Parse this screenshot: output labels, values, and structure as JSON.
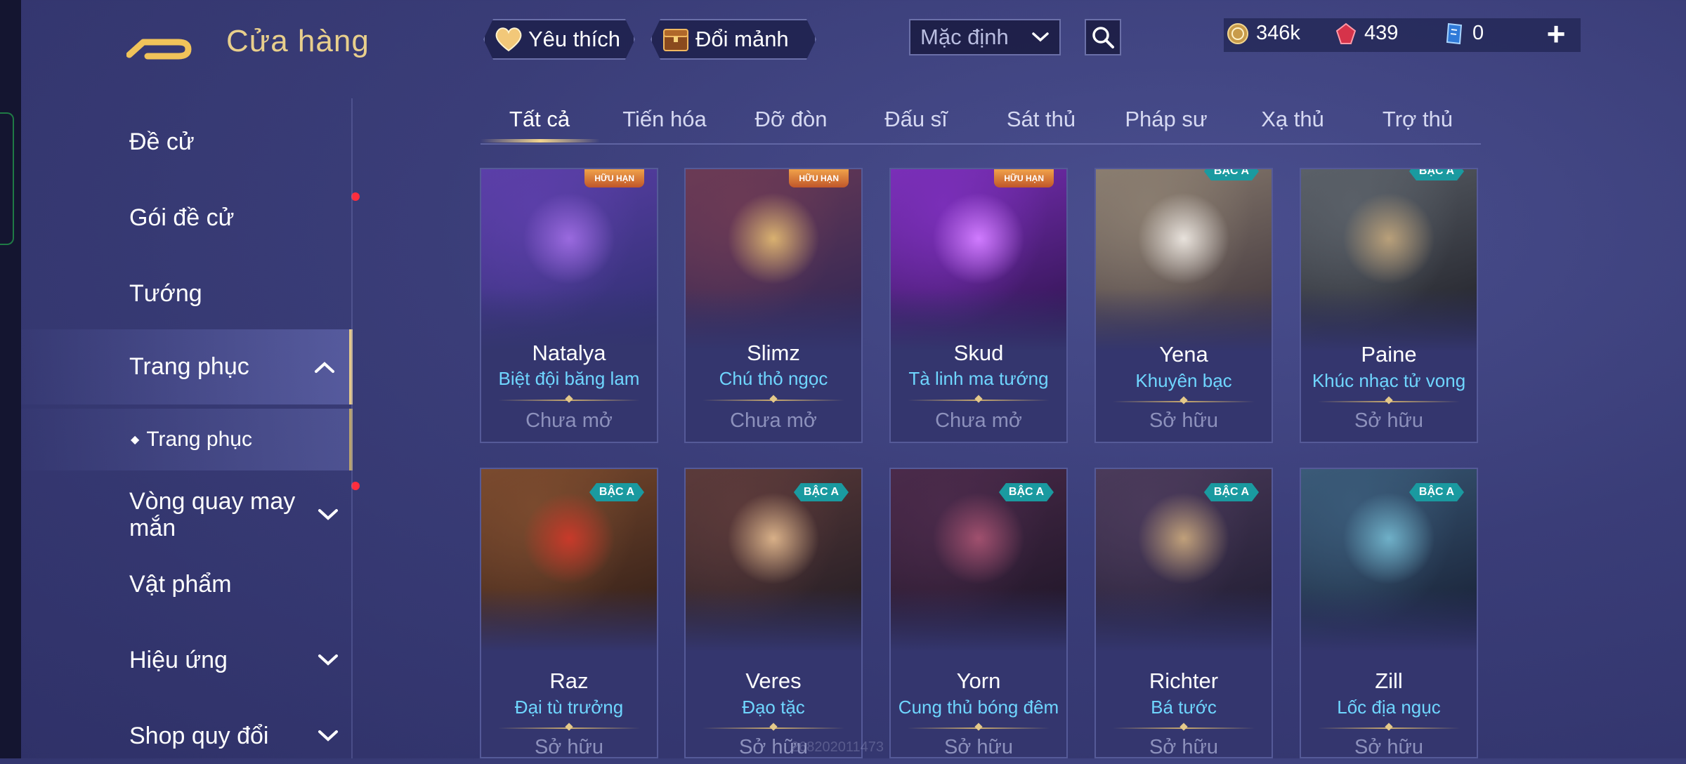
{
  "header": {
    "title": "Cửa hàng",
    "favorites_label": "Yêu thích",
    "fragments_label": "Đổi mảnh",
    "sort_value": "Mặc định",
    "currencies": {
      "gold": "346k",
      "ruby": "439",
      "voucher": "0"
    },
    "add_label": "+"
  },
  "sidebar": {
    "items": [
      {
        "label": "Đề cử"
      },
      {
        "label": "Gói đề cử"
      },
      {
        "label": "Tướng"
      },
      {
        "label": "Trang phục"
      },
      {
        "label": "Trang phục"
      },
      {
        "label": "Vòng quay may mắn"
      },
      {
        "label": "Vật phẩm"
      },
      {
        "label": "Hiệu ứng"
      },
      {
        "label": "Shop quy đổi"
      }
    ]
  },
  "tabs": [
    {
      "label": "Tất cả"
    },
    {
      "label": "Tiến hóa"
    },
    {
      "label": "Đỡ đòn"
    },
    {
      "label": "Đấu sĩ"
    },
    {
      "label": "Sát thủ"
    },
    {
      "label": "Pháp sư"
    },
    {
      "label": "Xạ thủ"
    },
    {
      "label": "Trợ thủ"
    }
  ],
  "skins": [
    {
      "hero": "Natalya",
      "skin": "Biệt đội băng lam",
      "status": "Chưa mở",
      "badge": "HỮU HẠN",
      "art": [
        "#5b3fa8",
        "#2d2f6e",
        "#9a6adf"
      ]
    },
    {
      "hero": "Slimz",
      "skin": "Chú thỏ ngọc",
      "status": "Chưa mở",
      "badge": "HỮU HẠN",
      "art": [
        "#6b3a55",
        "#2c2555",
        "#d9b170"
      ]
    },
    {
      "hero": "Skud",
      "skin": "Tà linh ma tướng",
      "status": "Chưa mở",
      "badge": "HỮU HẠN",
      "art": [
        "#7a2fb8",
        "#2a1248",
        "#d07bff"
      ]
    },
    {
      "hero": "Yena",
      "skin": "Khuyên bạc",
      "status": "Sở hữu",
      "badge": "BẬC A",
      "art": [
        "#8a7d70",
        "#3b3038",
        "#e8e2dc"
      ]
    },
    {
      "hero": "Paine",
      "skin": "Khúc nhạc tử vong",
      "status": "Sở hữu",
      "badge": "BẬC A",
      "art": [
        "#5a6068",
        "#1c1c24",
        "#b9a07a"
      ]
    },
    {
      "hero": "Raz",
      "skin": "Đại tù trưởng",
      "status": "Sở hữu",
      "badge": "BẬC A",
      "art": [
        "#7a4a2e",
        "#2a1a16",
        "#c83a2a"
      ]
    },
    {
      "hero": "Veres",
      "skin": "Đạo tặc",
      "status": "Sở hữu",
      "badge": "BẬC A",
      "art": [
        "#5b3a3a",
        "#1d1a22",
        "#d8b088"
      ]
    },
    {
      "hero": "Yorn",
      "skin": "Cung thủ bóng đêm",
      "status": "Sở hữu",
      "badge": "BẬC A",
      "art": [
        "#4a2a4a",
        "#1a1424",
        "#a0506e"
      ]
    },
    {
      "hero": "Richter",
      "skin": "Bá tước",
      "status": "Sở hữu",
      "badge": "BẬC A",
      "art": [
        "#4a3a5a",
        "#1c1a2e",
        "#c0a07a"
      ]
    },
    {
      "hero": "Zill",
      "skin": "Lốc địa ngục",
      "status": "Sở hữu",
      "badge": "BẬC A",
      "art": [
        "#3a5a78",
        "#141a2e",
        "#6fb0c8"
      ]
    }
  ],
  "watermark": "268202011473",
  "colors": {
    "accent_gold": "#e8cf8c",
    "skin_name": "#6fd6ff",
    "notification": "#ff2d3d"
  }
}
